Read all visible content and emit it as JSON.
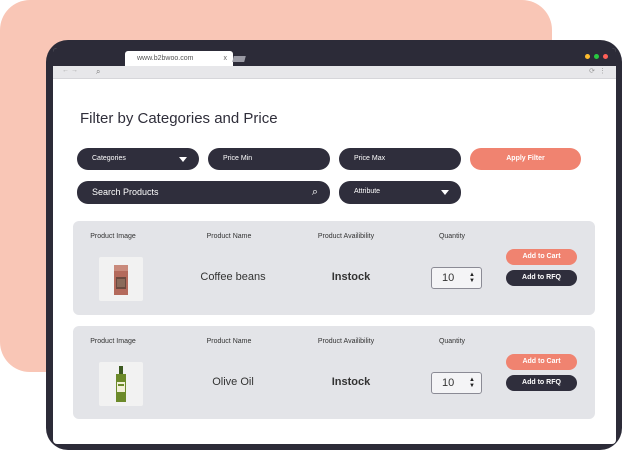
{
  "browser": {
    "tab_title": "www.b2bwoo.com",
    "tab_close": "x",
    "window_dots": {
      "red": "#ff5f57",
      "yellow": "#febc2e",
      "green": "#28c840"
    }
  },
  "page": {
    "title": "Filter by Categories and Price"
  },
  "filters": {
    "categories": "Categories",
    "price_min": "Price Min",
    "price_max": "Price Max",
    "apply": "Apply Filter",
    "search_placeholder": "Search Products",
    "attribute": "Attribute"
  },
  "columns": {
    "image": "Product Image",
    "name": "Product Name",
    "availability": "Product Availibility",
    "quantity": "Quantity"
  },
  "products": [
    {
      "name": "Coffee beans",
      "availability": "Instock",
      "quantity": "10",
      "image_icon": "coffee-bag-icon"
    },
    {
      "name": "Olive Oil",
      "availability": "Instock",
      "quantity": "10",
      "image_icon": "olive-oil-bottle-icon"
    }
  ],
  "actions": {
    "add_to_cart": "Add to Cart",
    "add_to_rfq": "Add to RFQ"
  },
  "colors": {
    "accent": "#f08370",
    "dark": "#2f2e3c",
    "card_bg": "#e3e4e8",
    "blob": "#f9c6b6"
  }
}
